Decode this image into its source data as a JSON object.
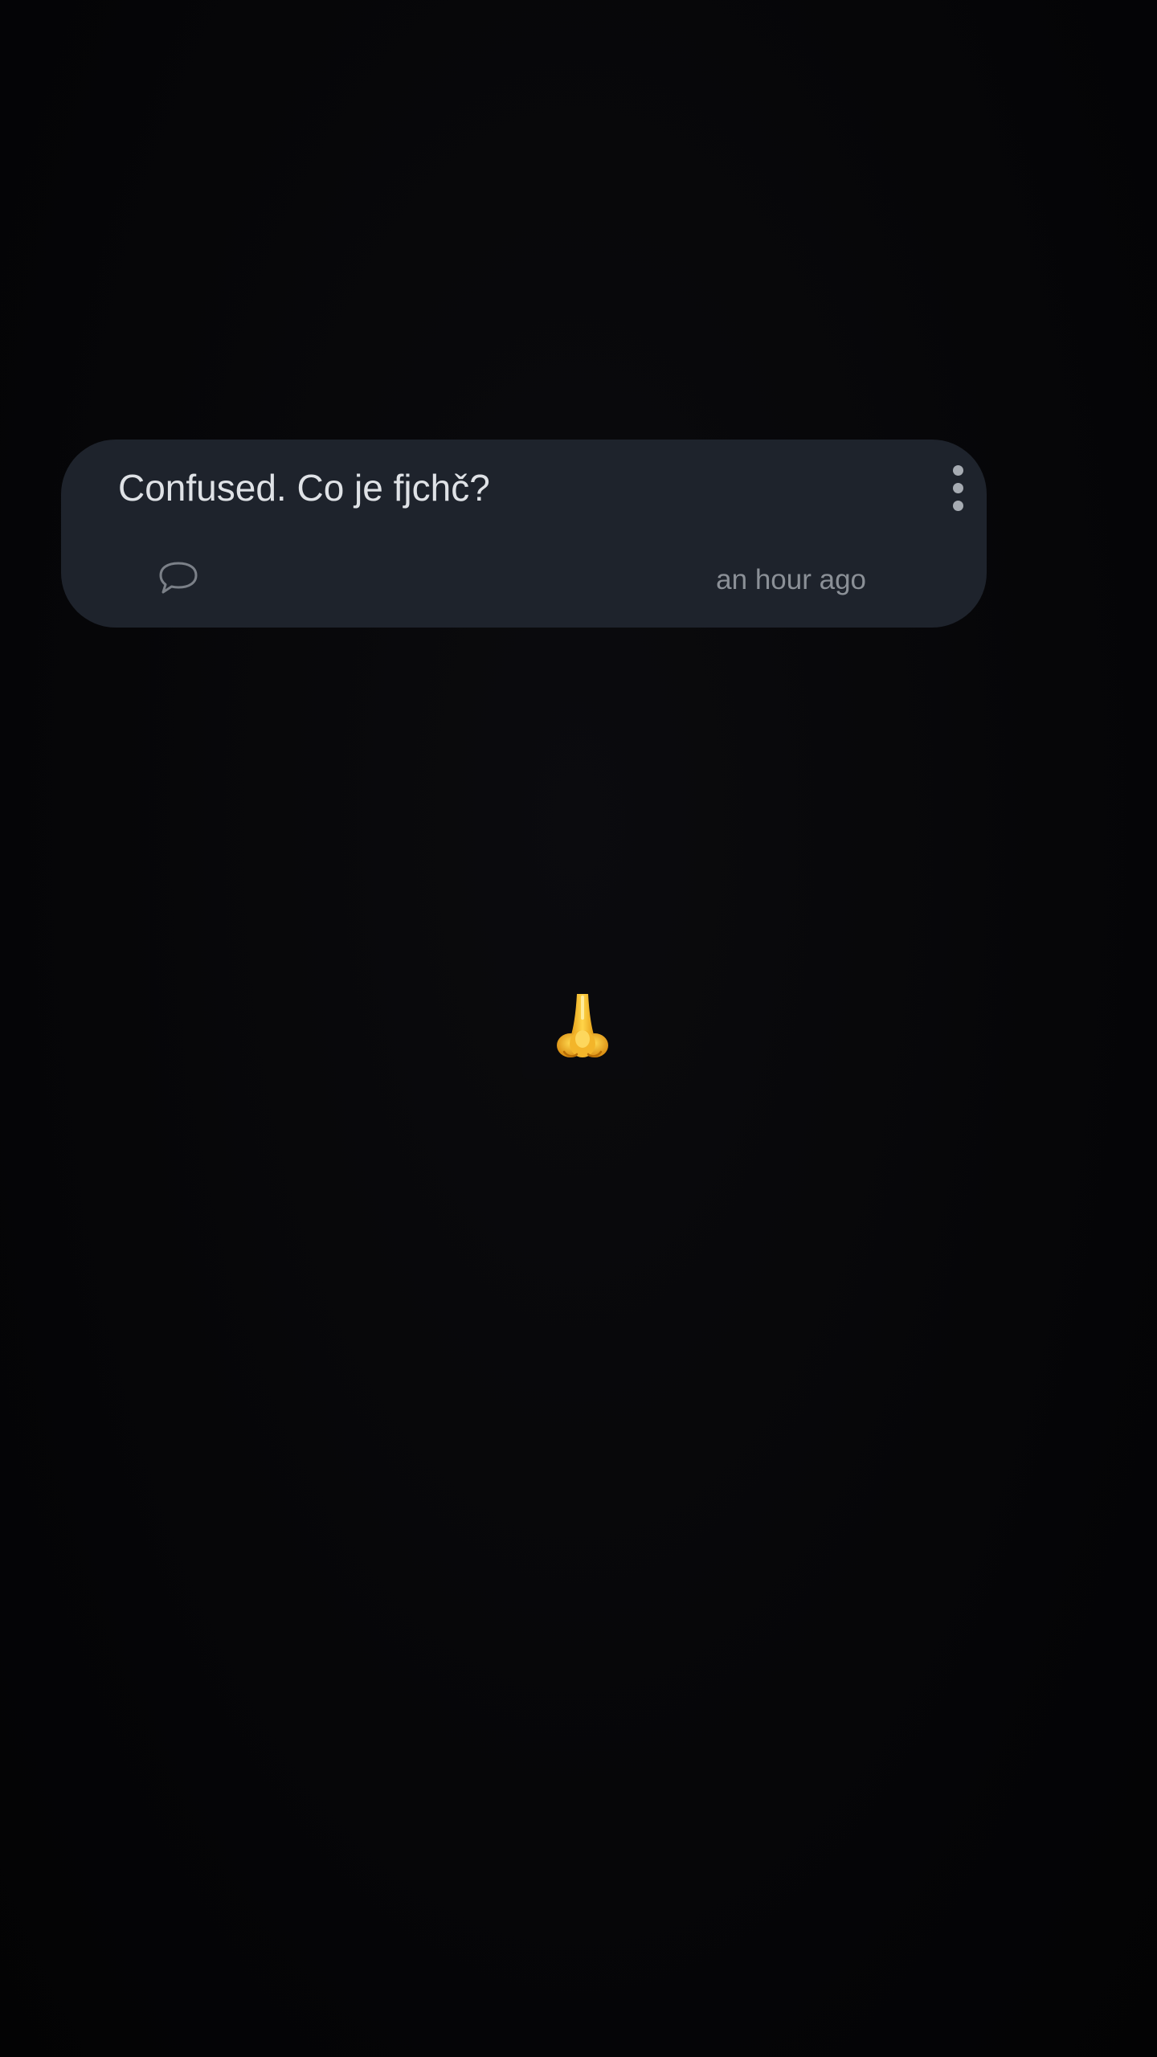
{
  "post": {
    "title": "Confused. Co je fjchč?",
    "timestamp": "an hour ago",
    "icons": {
      "menu": "more-vert-icon",
      "comment": "comment-icon"
    }
  },
  "emoji": {
    "icon": "nose-emoji-icon"
  },
  "colors": {
    "background": "#050507",
    "card": "#1e232c",
    "title_text": "#dfe2e6",
    "secondary_text": "#8b9097",
    "emoji_yellow": "#f4c430"
  }
}
